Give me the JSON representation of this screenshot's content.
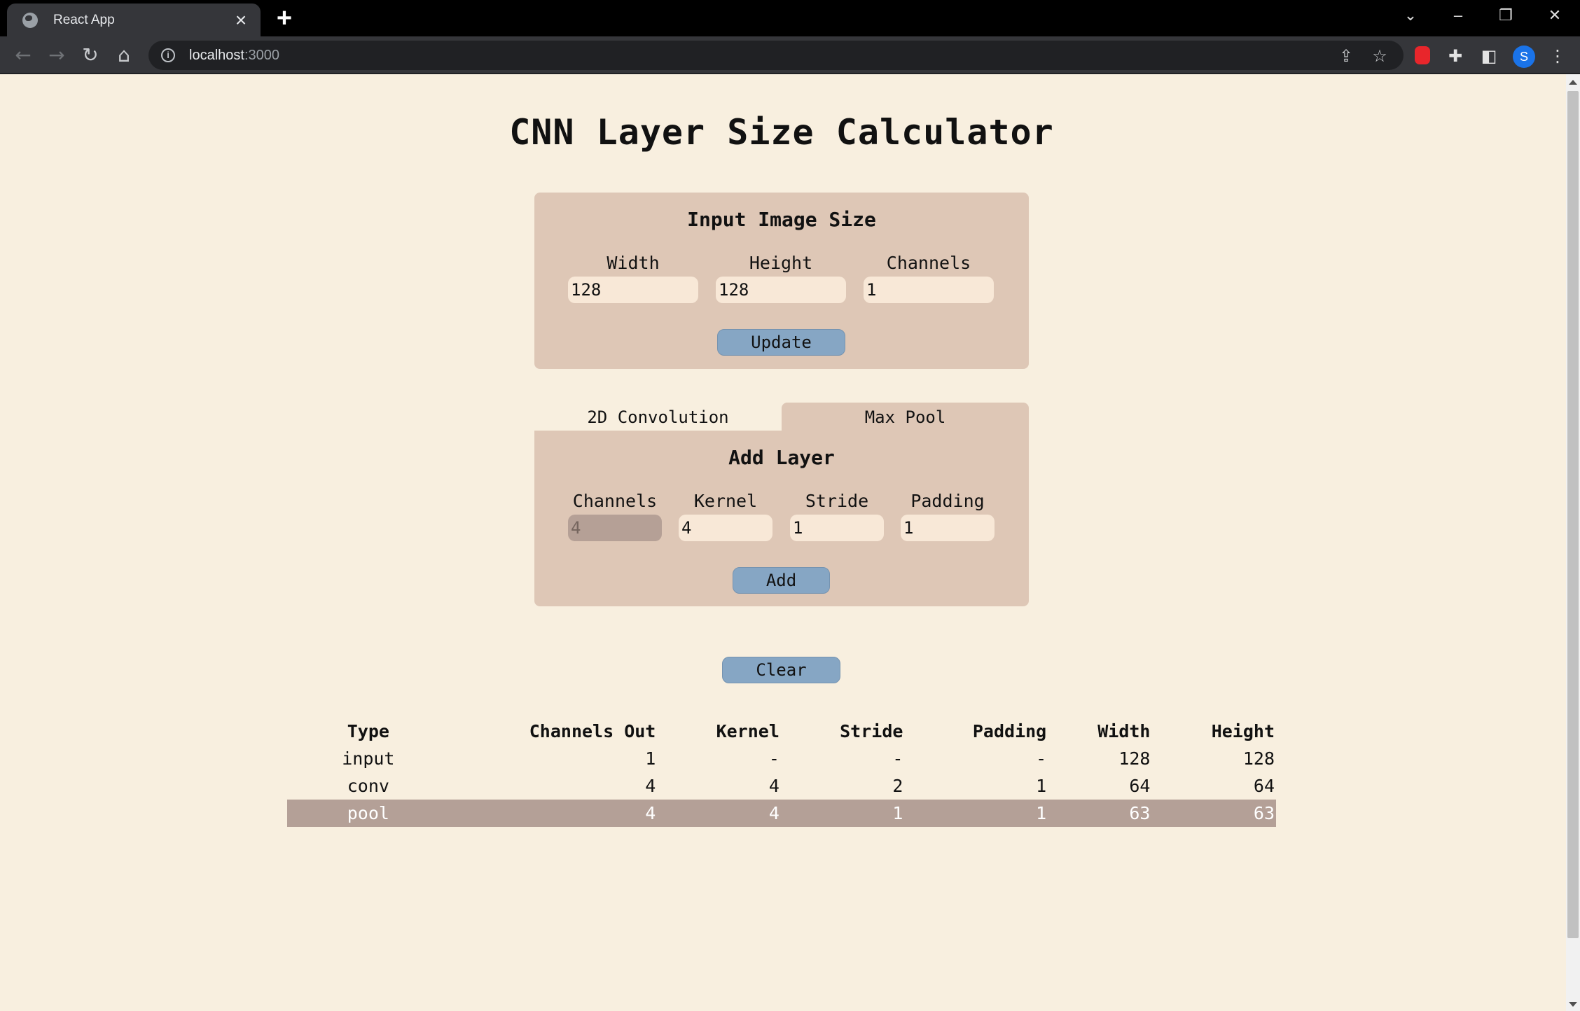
{
  "browser": {
    "tab_title": "React App",
    "tab_close_icon": "×",
    "new_tab_icon": "+",
    "url_host": "localhost",
    "url_port": ":3000",
    "profile_initial": "S"
  },
  "app": {
    "title": "CNN Layer Size Calculator",
    "input_panel": {
      "title": "Input Image Size",
      "width_label": "Width",
      "width_value": "128",
      "height_label": "Height",
      "height_value": "128",
      "channels_label": "Channels",
      "channels_value": "1",
      "update_label": "Update"
    },
    "layer_tabs": [
      {
        "label": "2D Convolution",
        "active": false
      },
      {
        "label": "Max Pool",
        "active": true
      }
    ],
    "add_layer_panel": {
      "title": "Add Layer",
      "channels_label": "Channels",
      "channels_value": "4",
      "kernel_label": "Kernel",
      "kernel_value": "4",
      "stride_label": "Stride",
      "stride_value": "1",
      "padding_label": "Padding",
      "padding_value": "1",
      "add_label": "Add"
    },
    "clear_label": "Clear",
    "table": {
      "headers": [
        "Type",
        "Channels Out",
        "Kernel",
        "Stride",
        "Padding",
        "Width",
        "Height"
      ],
      "rows": [
        [
          "input",
          "1",
          "-",
          "-",
          "-",
          "128",
          "128"
        ],
        [
          "conv",
          "4",
          "4",
          "2",
          "1",
          "64",
          "64"
        ],
        [
          "pool",
          "4",
          "4",
          "1",
          "1",
          "63",
          "63"
        ]
      ],
      "selected_row": 2
    }
  }
}
